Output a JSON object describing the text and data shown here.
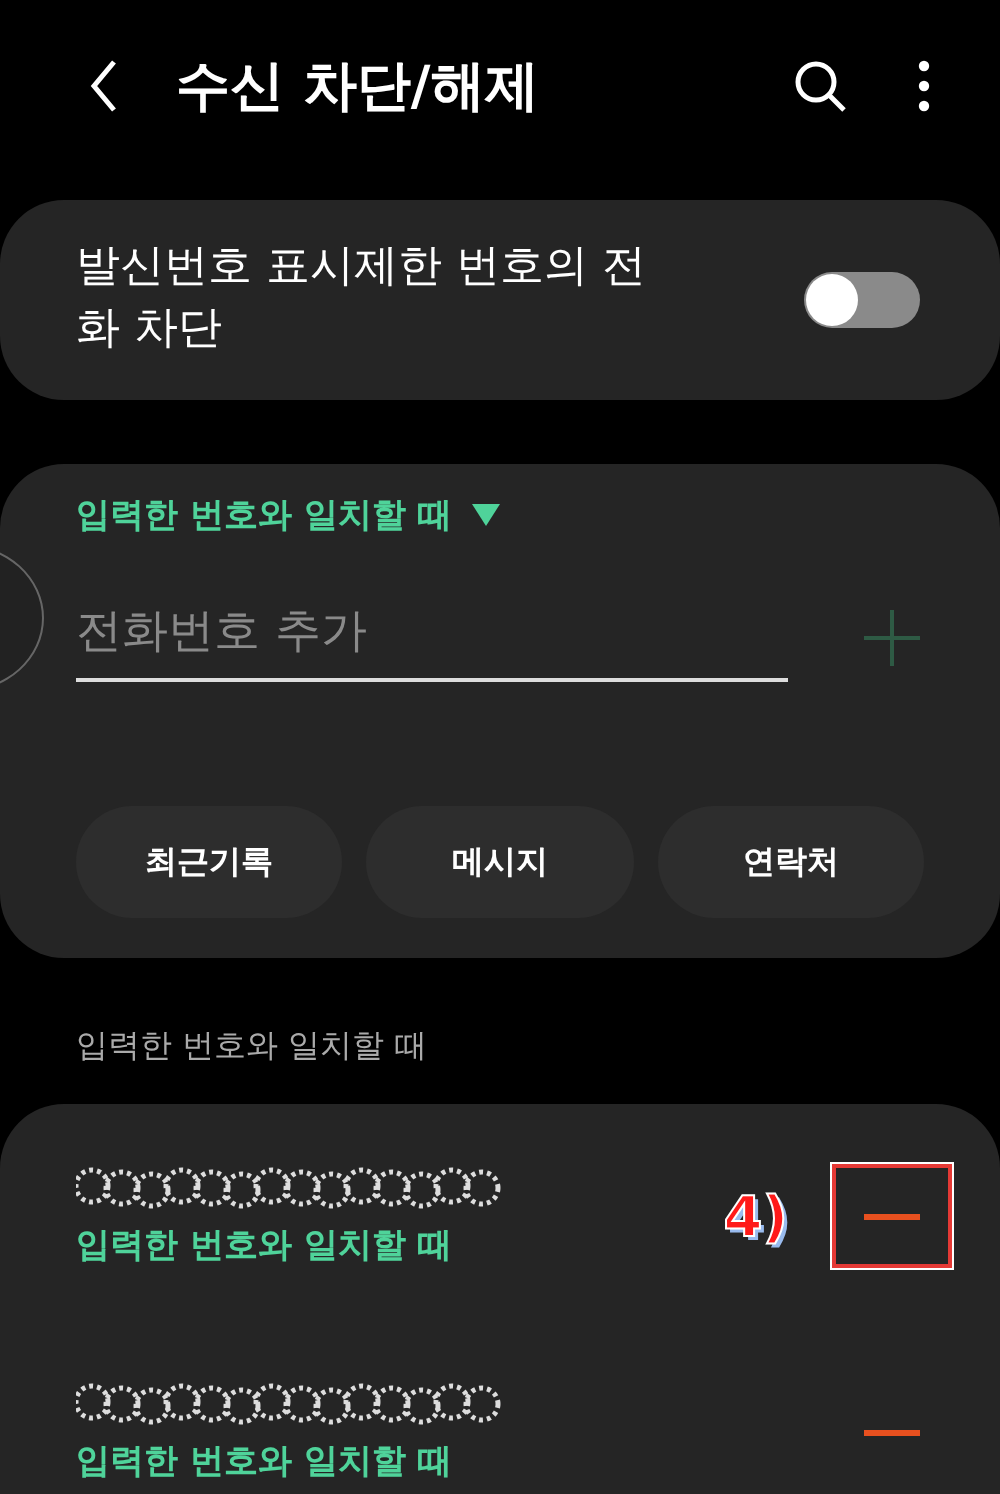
{
  "header": {
    "title": "수신 차단/해제"
  },
  "hidden_caller": {
    "label": "발신번호 표시제한 번호의 전화 차단",
    "on": false
  },
  "add_card": {
    "match_mode": "입력한 번호와 일치할 때",
    "placeholder": "전화번호 추가",
    "add_enabled": false,
    "buttons": [
      "최근기록",
      "메시지",
      "연락처"
    ]
  },
  "section_label": "입력한 번호와 일치할 때",
  "entries": [
    {
      "match": "입력한 번호와 일치할 때",
      "annotation": "4)"
    },
    {
      "match": "입력한 번호와 일치할 때"
    }
  ]
}
